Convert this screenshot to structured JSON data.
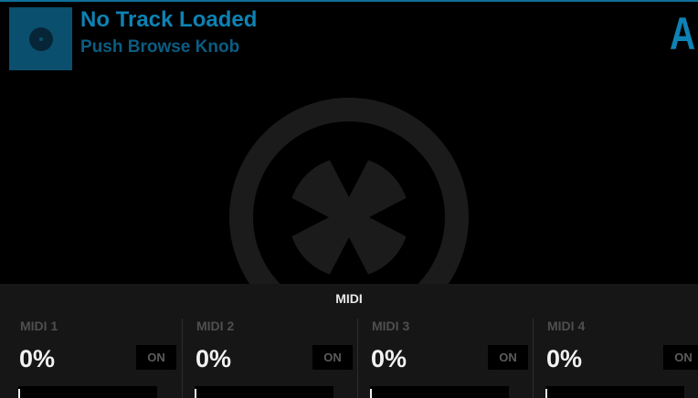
{
  "deck": {
    "letter": "A",
    "track_title": "No Track Loaded",
    "track_subtitle": "Push Browse Knob",
    "cover_icon": "record-disc-icon",
    "background_logo": "traktor-logo-icon"
  },
  "panel": {
    "title": "MIDI",
    "channels": [
      {
        "name": "MIDI 1",
        "value": "0%",
        "on_label": "ON",
        "level": 0
      },
      {
        "name": "MIDI 2",
        "value": "0%",
        "on_label": "ON",
        "level": 0
      },
      {
        "name": "MIDI 3",
        "value": "0%",
        "on_label": "ON",
        "level": 0
      },
      {
        "name": "MIDI 4",
        "value": "0%",
        "on_label": "ON",
        "level": 0
      }
    ]
  },
  "colors": {
    "accent": "#0e82b4",
    "accent_dark": "#0a5d82",
    "cover": "#0b4f6e",
    "panel": "#161616",
    "watermark": "#1b1b1b"
  }
}
